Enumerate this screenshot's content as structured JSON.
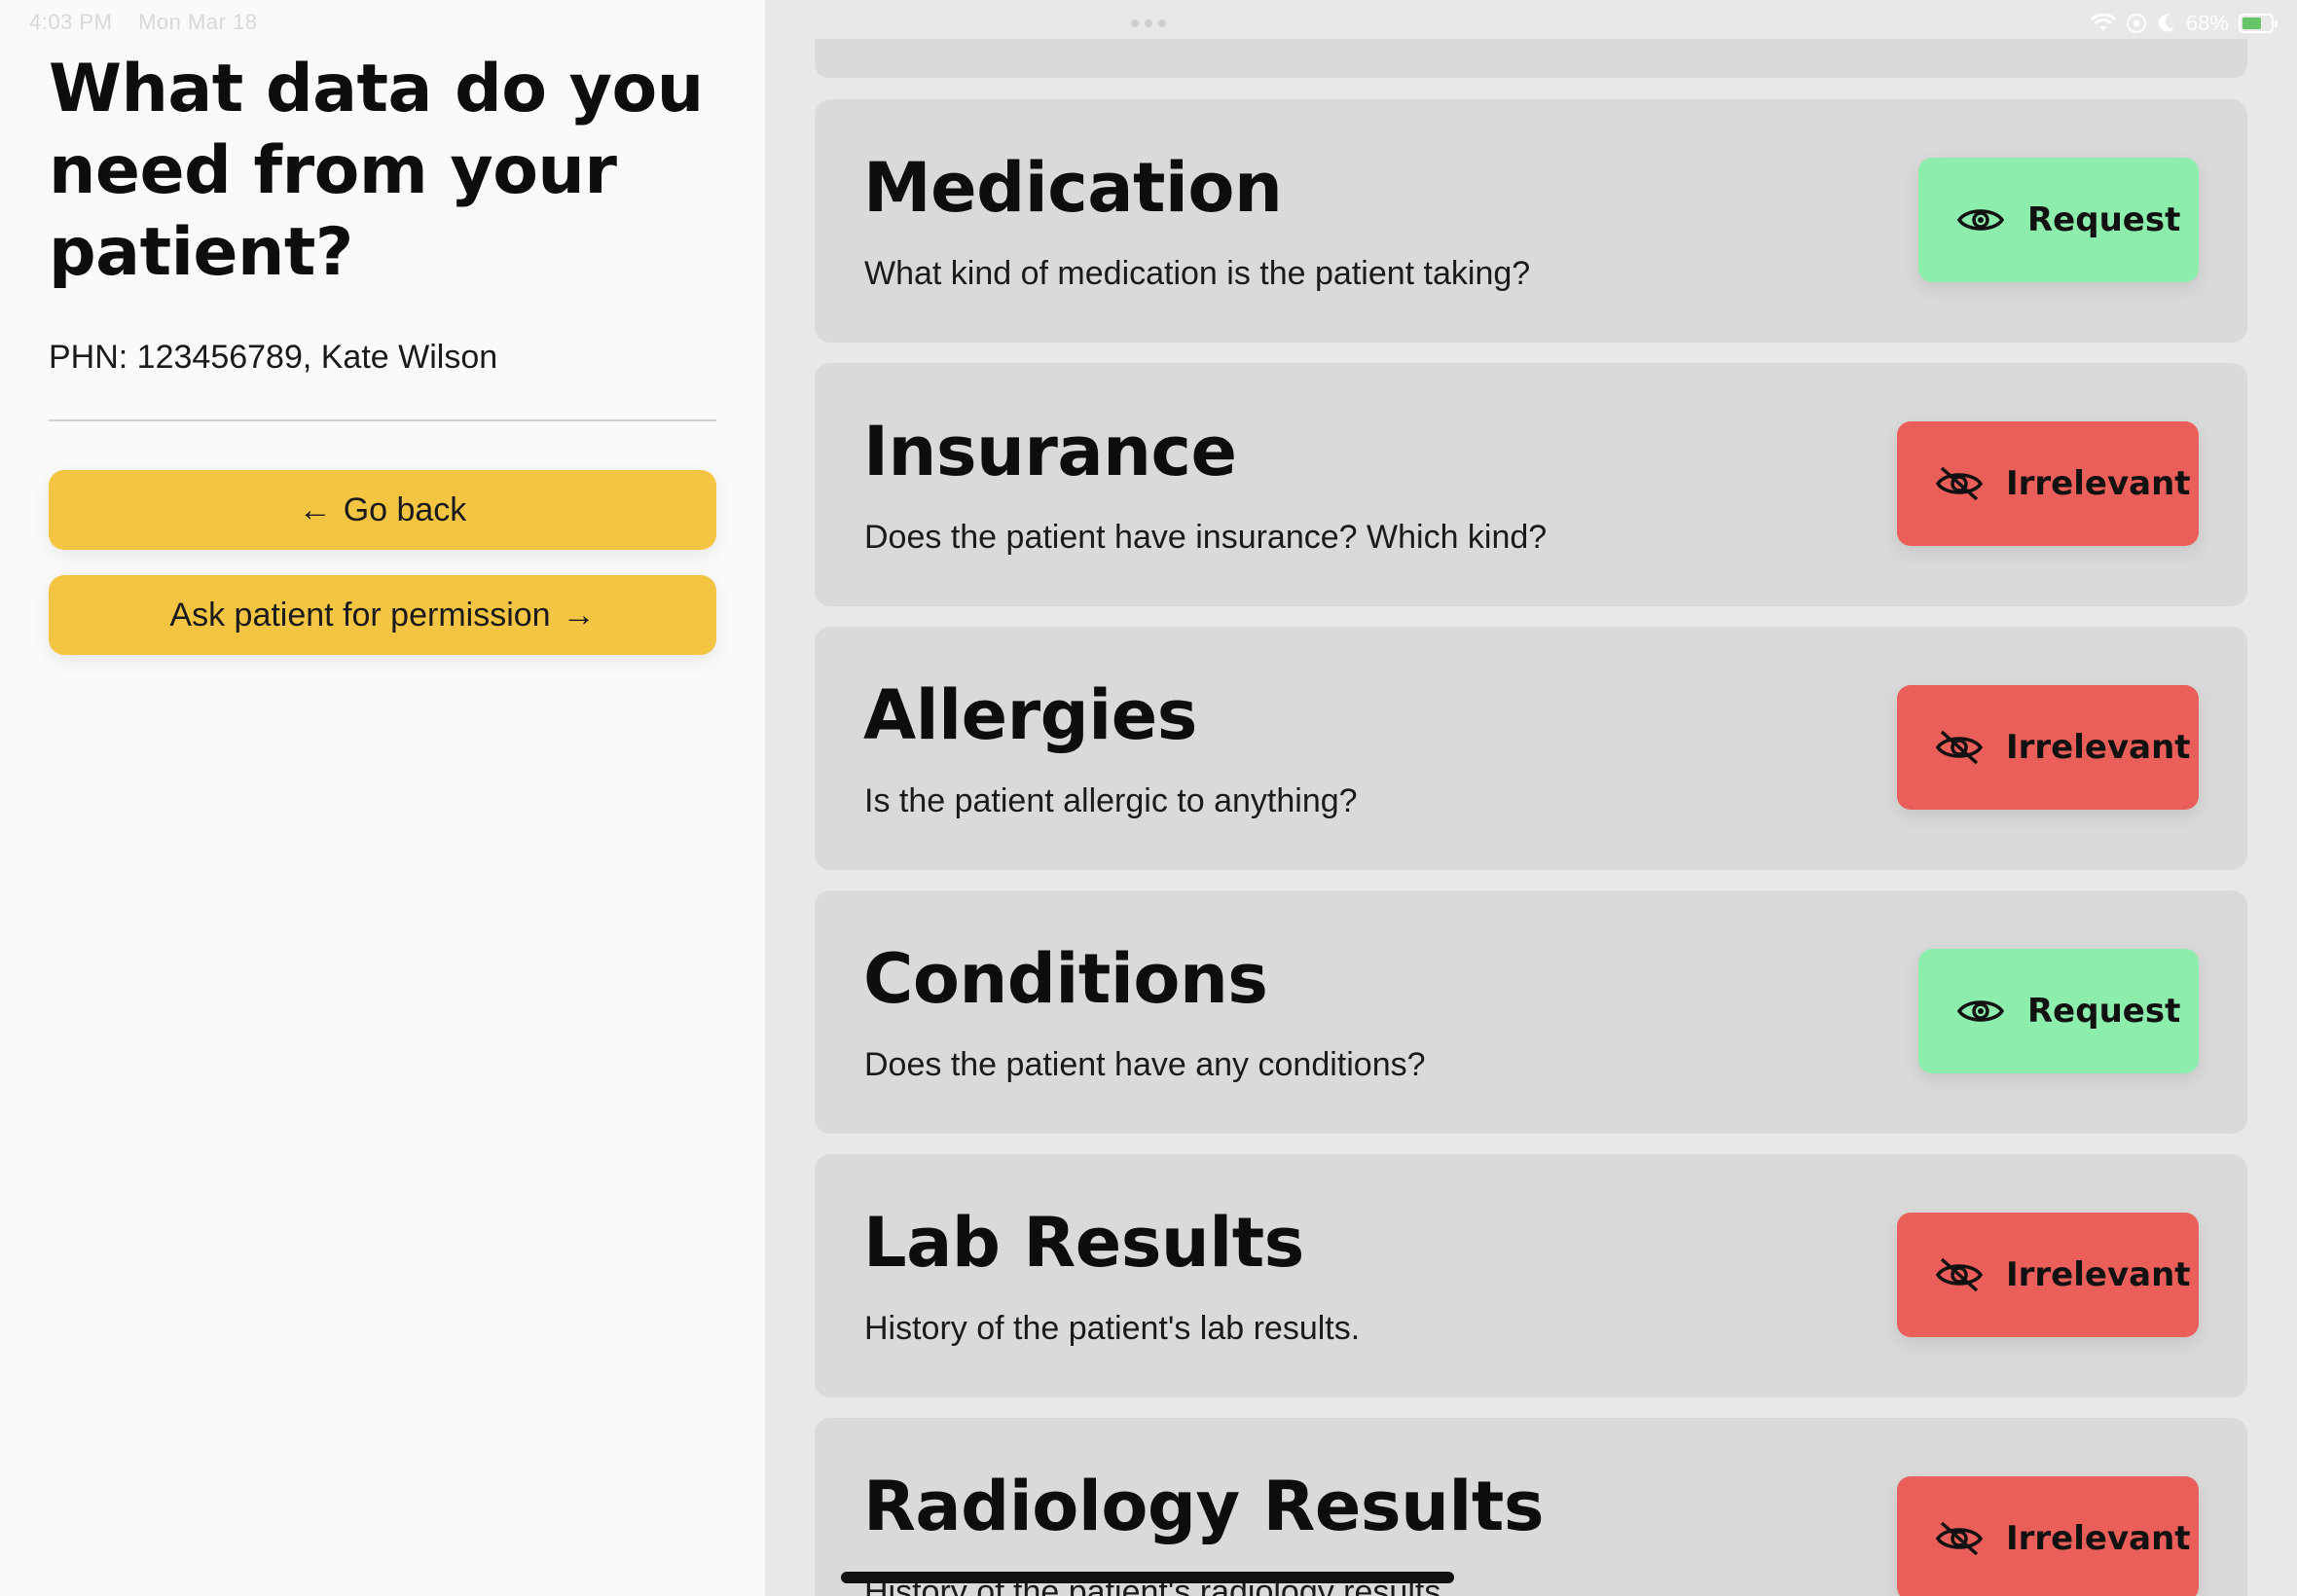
{
  "status_bar": {
    "time": "4:03 PM",
    "date": "Mon Mar 18",
    "battery": "68%",
    "battery_level": 0.68
  },
  "left": {
    "title": "What data do you need from your patient?",
    "patient_info": "PHN: 123456789, Kate Wilson",
    "back_label": "Go back",
    "back_icon": "←",
    "ask_label": "Ask patient for permission",
    "ask_icon": "→"
  },
  "cards": [
    {
      "title": "Medication",
      "description": "What kind of medication is the patient taking?",
      "status": "Request"
    },
    {
      "title": "Insurance",
      "description": "Does the patient have insurance? Which kind?",
      "status": "Irrelevant"
    },
    {
      "title": "Allergies",
      "description": "Is the patient allergic to anything?",
      "status": "Irrelevant"
    },
    {
      "title": "Conditions",
      "description": "Does the patient have any conditions?",
      "status": "Request"
    },
    {
      "title": "Lab Results",
      "description": "History of the patient's lab results.",
      "status": "Irrelevant"
    },
    {
      "title": "Radiology Results",
      "description": "History of the patient's radiology results.",
      "status": "Irrelevant"
    }
  ],
  "colors": {
    "request": "#8cedac",
    "irrelevant": "#ea5f59",
    "primary_button": "#f4c443"
  },
  "icons": {
    "request": "eye-icon",
    "irrelevant": "eye-off-icon"
  }
}
